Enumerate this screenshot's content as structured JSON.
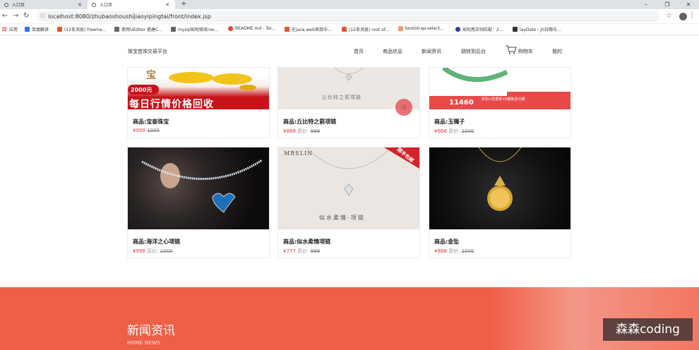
{
  "browser": {
    "tabs": [
      {
        "title": "入口页"
      },
      {
        "title": "入口页"
      }
    ],
    "url": "localhost:8080/zhubaoshoushijiaoyipingtai/front/index.jsp",
    "bookmarks": [
      {
        "label": "应用",
        "color": "#d93025"
      },
      {
        "label": "百度翻译",
        "color": "#2d6ff7"
      },
      {
        "label": "(12条消息) freema...",
        "color": "#e4572e"
      },
      {
        "label": "使用UEditor 搭建C...",
        "color": "#666666"
      },
      {
        "label": "mysql如何修改roo...",
        "color": "#666666"
      },
      {
        "label": "README.md - Ter...",
        "color": "#ea4335"
      },
      {
        "label": "在java web项目中...",
        "color": "#e4572e"
      },
      {
        "label": "(12条消息) root of...",
        "color": "#e4572e"
      },
      {
        "label": "bootstrap-select...",
        "color": "#f29b6b"
      },
      {
        "label": "如何用正则匹配：2...",
        "color": "#2d3ba8"
      },
      {
        "label": "layDate - JS日期与...",
        "color": "#333333"
      }
    ]
  },
  "header": {
    "brand": "珠宝首饰交易平台",
    "nav": [
      "首页",
      "商品信息",
      "新闻资讯",
      "跳转到后台",
      "购物车",
      "我的"
    ]
  },
  "products": [
    {
      "name": "商品:宝泰珠宝",
      "price": "¥999",
      "orig_label": "",
      "orig": "1000"
    },
    {
      "name": "商品:丘比特之箭项链",
      "price": "¥888",
      "orig_label": "原价:",
      "orig": "999"
    },
    {
      "name": "商品:玉镯子",
      "price": "¥666",
      "orig_label": "原价:",
      "orig": "1000"
    },
    {
      "name": "商品:海洋之心项链",
      "price": "¥998",
      "orig_label": "原价:",
      "orig": "1000"
    },
    {
      "name": "商品:似水柔情项链",
      "price": "¥777",
      "orig_label": "原价:",
      "orig": "999"
    },
    {
      "name": "商品:金坠",
      "price": "¥888",
      "orig_label": "原价:",
      "orig": "1000"
    }
  ],
  "image_text": {
    "banner1_word": "宝",
    "banner1_badge": "2000元",
    "banner1_strip": "每日行情价格回收",
    "pendant2": "丘比特之箭项链",
    "jade_num": "11460",
    "jade_txt": "折扣+优惠券+6期免息分期",
    "mrs_logo": "MRSLIN",
    "mrs_ribbon": "顺丰包邮",
    "mrs_caption": "似水柔情-项链"
  },
  "news": {
    "title": "新闻资讯",
    "subtitle": "HOME NEWS"
  },
  "watermark": "森森coding",
  "colors": {
    "accent": "#ef5f47",
    "price": "#e4393c"
  }
}
